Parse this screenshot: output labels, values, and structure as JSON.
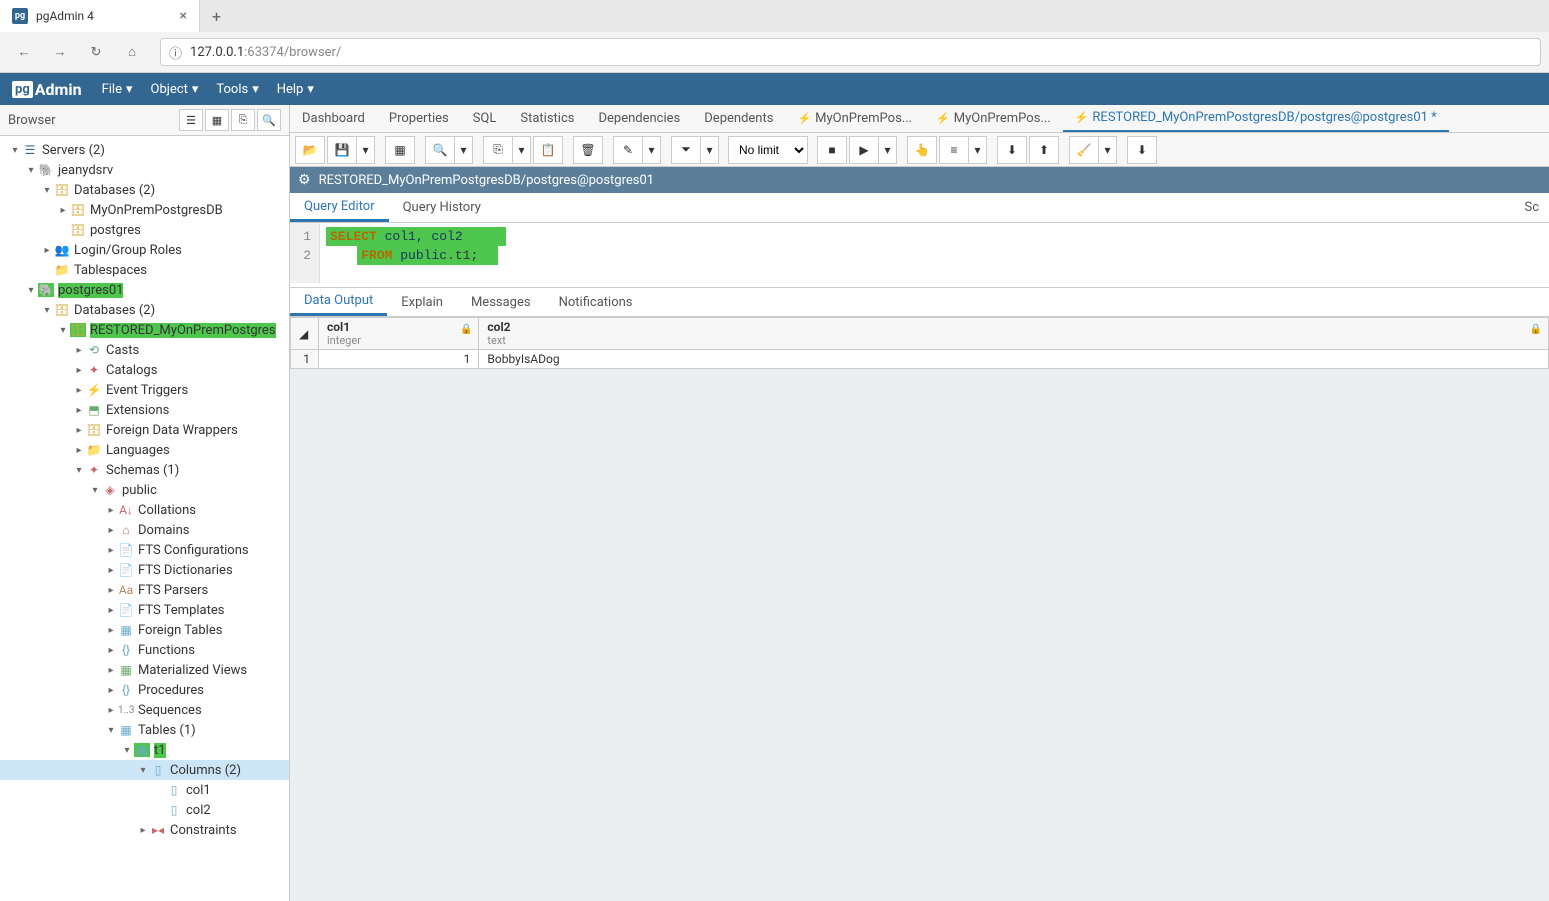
{
  "browser": {
    "tab_title": "pgAdmin 4",
    "url_host": "127.0.0.1",
    "url_rest": ":63374/browser/"
  },
  "pga": {
    "menus": [
      "File",
      "Object",
      "Tools",
      "Help"
    ]
  },
  "sidebar": {
    "title": "Browser",
    "tree": {
      "servers": "Servers (2)",
      "srv1": "jeanydsrv",
      "srv1_dbs": "Databases (2)",
      "srv1_db1": "MyOnPremPostgresDB",
      "srv1_db2": "postgres",
      "srv1_login": "Login/Group Roles",
      "srv1_ts": "Tablespaces",
      "srv2": "postgres01",
      "srv2_dbs": "Databases (2)",
      "restored": "RESTORED_MyOnPremPostgres",
      "casts": "Casts",
      "catalogs": "Catalogs",
      "evtrig": "Event Triggers",
      "ext": "Extensions",
      "fdw": "Foreign Data Wrappers",
      "lang": "Languages",
      "schemas": "Schemas (1)",
      "public": "public",
      "collations": "Collations",
      "domains": "Domains",
      "ftsconf": "FTS Configurations",
      "ftsdict": "FTS Dictionaries",
      "ftspar": "FTS Parsers",
      "ftstmpl": "FTS Templates",
      "ftables": "Foreign Tables",
      "funcs": "Functions",
      "mviews": "Materialized Views",
      "procs": "Procedures",
      "seqs": "Sequences",
      "tables": "Tables (1)",
      "t1": "t1",
      "columns": "Columns (2)",
      "col1": "col1",
      "col2": "col2",
      "constraints": "Constraints"
    }
  },
  "content_tabs": {
    "dashboard": "Dashboard",
    "properties": "Properties",
    "sql": "SQL",
    "statistics": "Statistics",
    "dependencies": "Dependencies",
    "dependents": "Dependents",
    "qt1": "MyOnPremPos...",
    "qt2": "MyOnPremPos...",
    "qt3": "RESTORED_MyOnPremPostgresDB/postgres@postgres01 *"
  },
  "qtoolbar": {
    "nolimit": "No limit"
  },
  "qt_title": "RESTORED_MyOnPremPostgresDB/postgres@postgres01",
  "editor_tabs": {
    "qe": "Query Editor",
    "qh": "Query History",
    "sc": "Sc"
  },
  "sql": {
    "line1_num": "1",
    "line2_num": "2",
    "kw_select": "SELECT",
    "cols": " col1, col2",
    "kw_from": "FROM",
    "schema": " public",
    "dot_table": ".t1;"
  },
  "result_tabs": {
    "data": "Data Output",
    "explain": "Explain",
    "msg": "Messages",
    "notif": "Notifications"
  },
  "grid": {
    "col1_name": "col1",
    "col1_type": "integer",
    "col2_name": "col2",
    "col2_type": "text",
    "row1_num": "1",
    "row1_c1": "1",
    "row1_c2": "BobbyIsADog"
  }
}
